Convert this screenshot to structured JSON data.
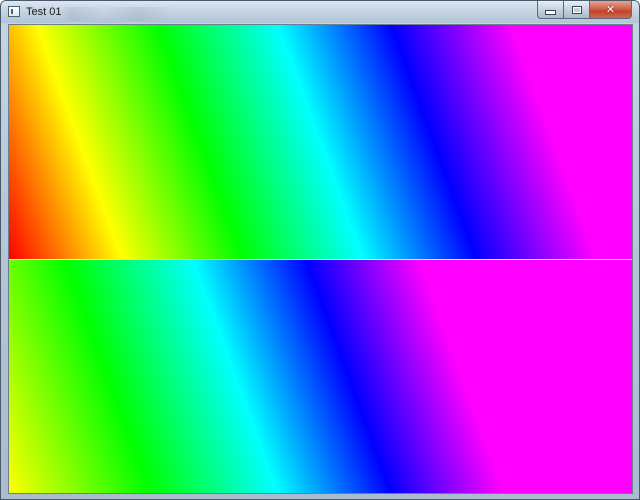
{
  "window": {
    "title": "Test 01",
    "controls": {
      "minimize_icon": "minimize-icon",
      "maximize_icon": "maximize-icon",
      "close_icon": "close-icon",
      "close_glyph": "✕"
    }
  },
  "canvas": {
    "colors": [
      "#ff0000",
      "#ffff00",
      "#00ff00",
      "#00ffff",
      "#0000ff",
      "#ff00ff"
    ],
    "divider_color": "#e6e6e6"
  }
}
